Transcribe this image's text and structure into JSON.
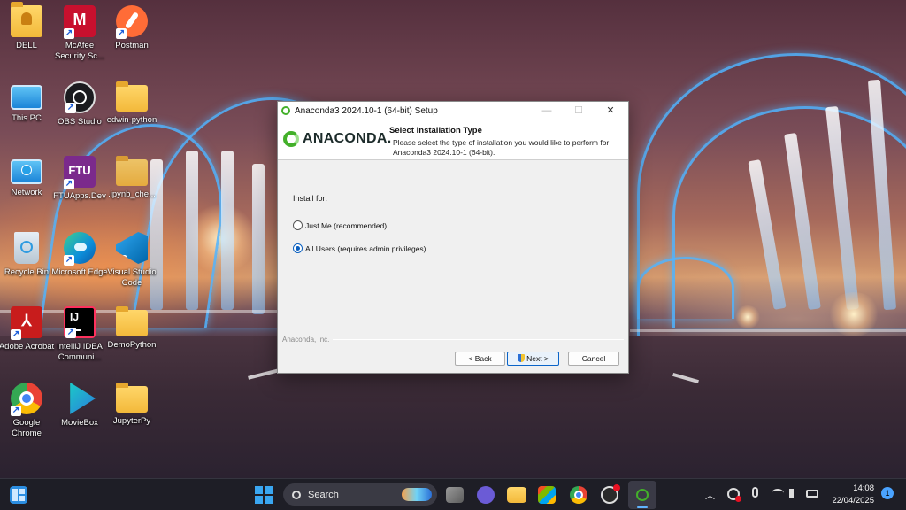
{
  "desktop": {
    "icons": [
      {
        "label": "DELL",
        "icon": "folder-user-icon"
      },
      {
        "label": "McAfee Security Sc...",
        "icon": "mcafee-icon"
      },
      {
        "label": "Postman",
        "icon": "postman-icon"
      },
      {
        "label": "This PC",
        "icon": "monitor-icon"
      },
      {
        "label": "OBS Studio",
        "icon": "obs-icon"
      },
      {
        "label": "edwin-python",
        "icon": "folder-icon"
      },
      {
        "label": "Network",
        "icon": "network-icon"
      },
      {
        "label": "FTUApps.Dev",
        "icon": "ftu-icon"
      },
      {
        "label": ".ipynb_che...",
        "icon": "folder-icon"
      },
      {
        "label": "Recycle Bin",
        "icon": "recycle-bin-icon"
      },
      {
        "label": "Microsoft Edge",
        "icon": "edge-icon"
      },
      {
        "label": "Visual Studio Code",
        "icon": "vscode-icon"
      },
      {
        "label": "Adobe Acrobat",
        "icon": "acrobat-icon"
      },
      {
        "label": "IntelliJ IDEA Communi...",
        "icon": "intellij-icon"
      },
      {
        "label": "DemoPython",
        "icon": "folder-icon"
      },
      {
        "label": "Google Chrome",
        "icon": "chrome-icon"
      },
      {
        "label": "MovieBox",
        "icon": "moviebox-icon"
      },
      {
        "label": "JupyterPy",
        "icon": "folder-icon"
      }
    ]
  },
  "installer": {
    "window_title": "Anaconda3 2024.10-1 (64-bit) Setup",
    "logo_text": "ANACONDA.",
    "header_title": "Select Installation Type",
    "header_desc": "Please select the type of installation you would like to perform for Anaconda3 2024.10-1 (64-bit).",
    "install_for_label": "Install for:",
    "options": [
      {
        "label": "Just Me (recommended)",
        "selected": false
      },
      {
        "label": "All Users (requires admin privileges)",
        "selected": true
      }
    ],
    "branding": "Anaconda, Inc.",
    "back_label": "< Back",
    "next_label": "Next >",
    "cancel_label": "Cancel",
    "min_glyph": "—",
    "max_glyph": "☐",
    "close_glyph": "✕"
  },
  "taskbar": {
    "search_placeholder": "Search",
    "time": "14:08",
    "date": "22/04/2025",
    "notification_count": "1"
  },
  "colors": {
    "anaconda_green": "#43b02a",
    "accent_blue": "#0a5fbf"
  }
}
